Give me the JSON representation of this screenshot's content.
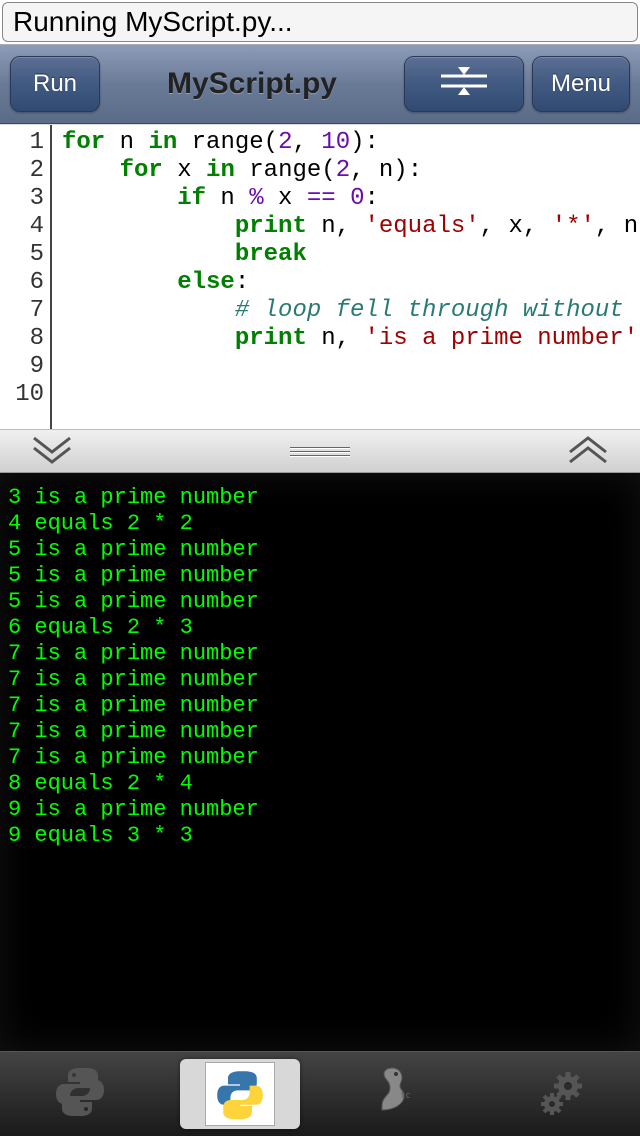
{
  "status": {
    "text": "Running MyScript.py..."
  },
  "toolbar": {
    "run_label": "Run",
    "menu_label": "Menu",
    "title": "MyScript.py"
  },
  "editor": {
    "line_numbers": [
      "1",
      "2",
      "3",
      "4",
      "5",
      "6",
      "7",
      "8",
      "9",
      "10"
    ],
    "lines": [
      [
        [
          "kw",
          "for"
        ],
        [
          "",
          " n "
        ],
        [
          "kw",
          "in"
        ],
        [
          "",
          " range("
        ],
        [
          "op",
          "2"
        ],
        [
          null,
          ", "
        ],
        [
          "op",
          "10"
        ],
        [
          null,
          "):"
        ]
      ],
      [
        [
          null,
          "    "
        ],
        [
          "kw",
          "for"
        ],
        [
          null,
          " x "
        ],
        [
          "kw",
          "in"
        ],
        [
          null,
          " range("
        ],
        [
          "op",
          "2"
        ],
        [
          null,
          ", n):"
        ]
      ],
      [
        [
          null,
          "        "
        ],
        [
          "kw",
          "if"
        ],
        [
          null,
          " n "
        ],
        [
          "op",
          "%"
        ],
        [
          null,
          " x "
        ],
        [
          "op",
          "=="
        ],
        [
          null,
          " "
        ],
        [
          "op",
          "0"
        ],
        [
          null,
          ":"
        ]
      ],
      [
        [
          null,
          "            "
        ],
        [
          "kw",
          "print"
        ],
        [
          null,
          " n, "
        ],
        [
          "str",
          "'equals'"
        ],
        [
          null,
          ", x, "
        ],
        [
          "str",
          "'*'"
        ],
        [
          null,
          ", n"
        ]
      ],
      [
        [
          null,
          "            "
        ],
        [
          "kw",
          "break"
        ]
      ],
      [
        [
          null,
          "        "
        ],
        [
          "kw",
          "else"
        ],
        [
          null,
          ":"
        ]
      ],
      [
        [
          null,
          "            "
        ],
        [
          "cmt",
          "# loop fell through without "
        ]
      ],
      [
        [
          null,
          "            "
        ],
        [
          "kw",
          "print"
        ],
        [
          null,
          " n, "
        ],
        [
          "str",
          "'is a prime number'"
        ]
      ],
      [
        [
          null,
          ""
        ]
      ],
      [
        [
          null,
          ""
        ]
      ]
    ]
  },
  "console": {
    "lines": [
      "3 is a prime number",
      "4 equals 2 * 2",
      "5 is a prime number",
      "5 is a prime number",
      "5 is a prime number",
      "6 equals 2 * 3",
      "7 is a prime number",
      "7 is a prime number",
      "7 is a prime number",
      "7 is a prime number",
      "7 is a prime number",
      "8 equals 2 * 4",
      "9 is a prime number",
      "9 equals 3 * 3"
    ]
  },
  "tabs": {
    "items": [
      "python",
      "script",
      "game",
      "settings"
    ],
    "active_index": 1
  }
}
